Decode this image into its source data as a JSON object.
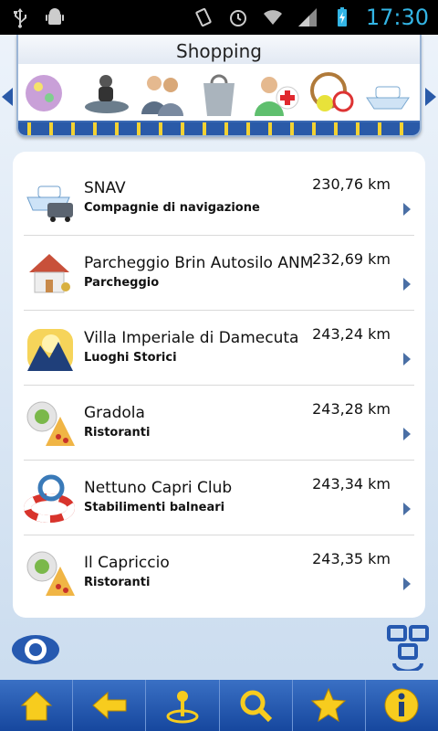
{
  "status_bar": {
    "time": "17:30",
    "icons": [
      "usb-icon",
      "android-debug-icon",
      "vibrate-icon",
      "alarm-icon",
      "wifi-icon",
      "signal-icon",
      "battery-charging-icon"
    ]
  },
  "category_header": {
    "title": "Shopping",
    "icons": [
      "disco-ball-icon",
      "jet-ski-icon",
      "people-icon",
      "capri-shopping-bag-icon",
      "doctor-icon",
      "sports-icon",
      "ferry-icon"
    ],
    "accent": "#2a5aa8"
  },
  "list": {
    "items": [
      {
        "name": "SNAV",
        "category": "Compagnie di navigazione",
        "distance": "230,76 km",
        "icon": "ferry-bus-icon"
      },
      {
        "name": "Parcheggio Brin Autosilo ANM",
        "category": "Parcheggio",
        "distance": "232,69 km",
        "icon": "house-key-icon"
      },
      {
        "name": "Villa Imperiale di Damecuta",
        "category": "Luoghi Storici",
        "distance": "243,24 km",
        "icon": "landscape-icon"
      },
      {
        "name": "Gradola",
        "category": "Ristoranti",
        "distance": "243,28 km",
        "icon": "pizza-icon"
      },
      {
        "name": "Nettuno Capri Club",
        "category": "Stabilimenti balneari",
        "distance": "243,34 km",
        "icon": "lifebuoy-icon"
      },
      {
        "name": "Il Capriccio",
        "category": "Ristoranti",
        "distance": "243,35 km",
        "icon": "pizza-icon"
      }
    ]
  },
  "toolbar": {
    "buttons": [
      "home-icon",
      "back-arrow-icon",
      "map-pin-icon",
      "search-icon",
      "star-icon",
      "info-icon"
    ],
    "color": "#1f55ad"
  }
}
